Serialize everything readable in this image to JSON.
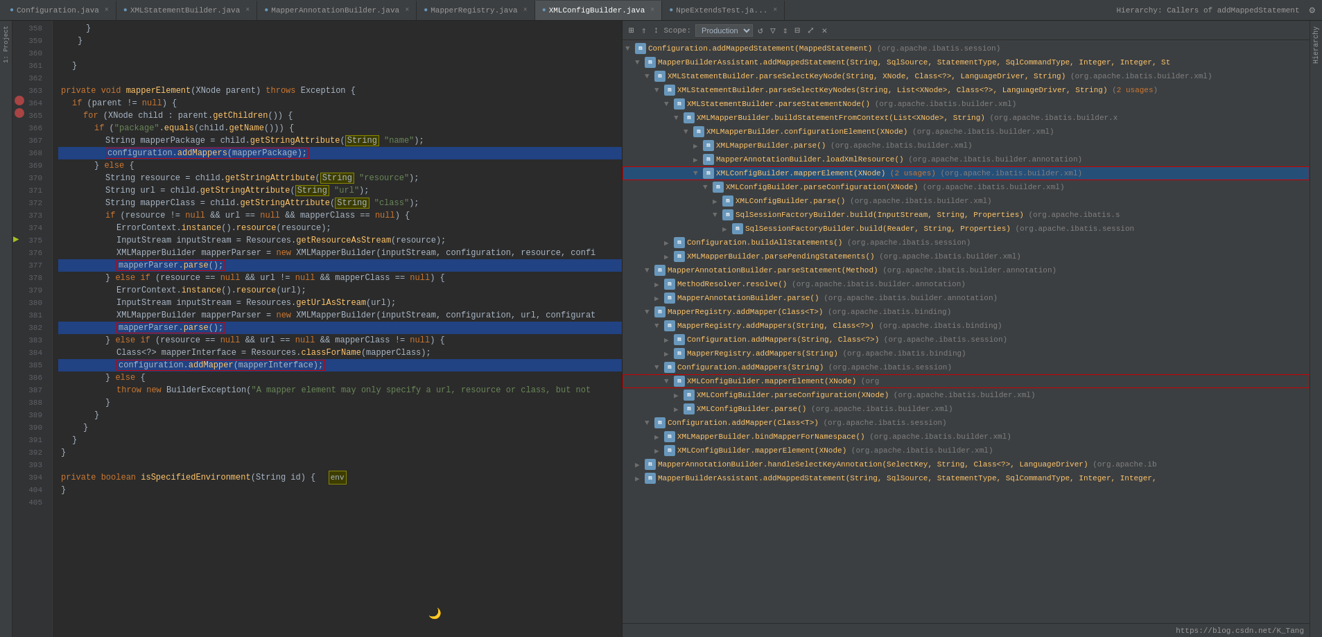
{
  "tabs": [
    {
      "label": "Configuration.java",
      "active": false,
      "color": "#6897bb"
    },
    {
      "label": "XMLStatementBuilder.java",
      "active": false,
      "color": "#6897bb"
    },
    {
      "label": "MapperAnnotationBuilder.java",
      "active": false,
      "color": "#6897bb"
    },
    {
      "label": "MapperRegistry.java",
      "active": false,
      "color": "#6897bb"
    },
    {
      "label": "XMLConfigBuilder.java",
      "active": true,
      "color": "#6897bb"
    },
    {
      "label": "NpeExtendsTest.ja...",
      "active": false,
      "color": "#6897bb"
    }
  ],
  "hierarchy_title": "Hierarchy: Callers of addMappedStatement",
  "scope": {
    "label": "Scope:",
    "value": "Production"
  },
  "toolbar_buttons": [
    "refresh",
    "settings",
    "expand",
    "locate",
    "export",
    "close"
  ],
  "code_lines": [
    {
      "num": "358",
      "code": "    }"
    },
    {
      "num": "359",
      "code": "    }"
    },
    {
      "num": "360",
      "code": ""
    },
    {
      "num": "361",
      "code": "    }"
    },
    {
      "num": "362",
      "code": ""
    },
    {
      "num": "363",
      "code": "    private void mapperElement(XNode parent) throws Exception {"
    },
    {
      "num": "364",
      "code": "        if (parent != null) {"
    },
    {
      "num": "365",
      "code": "            for (XNode child : parent.getChildren()) {"
    },
    {
      "num": "366",
      "code": "                if (\"package\".equals(child.getName())) {"
    },
    {
      "num": "367",
      "code": "                    String mapperPackage = child.getStringAttribute( \"name\");"
    },
    {
      "num": "368",
      "code": "                    configuration.addMappers(mapperPackage);",
      "highlight": true
    },
    {
      "num": "369",
      "code": "                } else {"
    },
    {
      "num": "370",
      "code": "                    String resource = child.getStringAttribute( \"resource\");"
    },
    {
      "num": "371",
      "code": "                    String url = child.getStringAttribute( \"url\");"
    },
    {
      "num": "372",
      "code": "                    String mapperClass = child.getStringAttribute( \"class\");"
    },
    {
      "num": "373",
      "code": "                    if (resource != null && url == null && mapperClass == null) {"
    },
    {
      "num": "374",
      "code": "                        ErrorContext.instance().resource(resource);"
    },
    {
      "num": "375",
      "code": "                        InputStream inputStream = Resources.getResourceAsStream(resource);"
    },
    {
      "num": "376",
      "code": "                        XMLMapperBuilder mapperParser = new XMLMapperBuilder(inputStream, configuration, resource, confi"
    },
    {
      "num": "377",
      "code": "                        mapperParser.parse();",
      "highlight": true
    },
    {
      "num": "378",
      "code": "                    } else if (resource == null && url != null && mapperClass == null) {"
    },
    {
      "num": "379",
      "code": "                        ErrorContext.instance().resource(url);"
    },
    {
      "num": "380",
      "code": "                        InputStream inputStream = Resources.getUrlAsStream(url);"
    },
    {
      "num": "381",
      "code": "                        XMLMapperBuilder mapperParser = new XMLMapperBuilder(inputStream, configuration, url, configurat"
    },
    {
      "num": "382",
      "code": "                        mapperParser.parse();",
      "highlight": true
    },
    {
      "num": "383",
      "code": "                    } else if (resource == null && url == null && mapperClass != null) {"
    },
    {
      "num": "384",
      "code": "                        Class<?> mapperInterface = Resources.classForName(mapperClass);"
    },
    {
      "num": "385",
      "code": "                        configuration.addMapper(mapperInterface);",
      "highlight": true
    },
    {
      "num": "386",
      "code": "                    } else {"
    },
    {
      "num": "387",
      "code": "                        throw new BuilderException(\"A mapper element may only specify a url, resource or class, but not"
    },
    {
      "num": "388",
      "code": "                    }"
    },
    {
      "num": "389",
      "code": "                }"
    },
    {
      "num": "390",
      "code": "            }"
    },
    {
      "num": "391",
      "code": "        }"
    },
    {
      "num": "392",
      "code": "    }"
    },
    {
      "num": "393",
      "code": ""
    },
    {
      "num": "394",
      "code": "    private boolean isSpecifiedEnvironment(String id) {"
    },
    {
      "num": "404",
      "code": "    }"
    }
  ],
  "hierarchy_items": [
    {
      "indent": 0,
      "arrow": "▼",
      "icon": "m",
      "text": "Configuration.addMappedStatement(MappedStatement)",
      "pkg": "(org.apache.ibatis.session)",
      "level": 0
    },
    {
      "indent": 1,
      "arrow": "▼",
      "icon": "m",
      "text": "MapperBuilderAssistant.addMappedStatement(String, SqlSource, StatementType, SqlCommandType, Integer, Integer, St",
      "pkg": "",
      "level": 1
    },
    {
      "indent": 2,
      "arrow": "▼",
      "icon": "m",
      "text": "XMLStatementBuilder.parseSelectKeyNode(String, XNode, Class<?>, LanguageDriver, String)",
      "pkg": "(org.apache.ibatis.builder.xml)",
      "level": 2
    },
    {
      "indent": 3,
      "arrow": "▼",
      "icon": "m",
      "text": "XMLStatementBuilder.parseSelectKeyNodes(String, List<XNode>, Class<?>, LanguageDriver, String)",
      "pkg": "(2 usages)",
      "level": 3
    },
    {
      "indent": 4,
      "arrow": "▼",
      "icon": "m",
      "text": "XMLStatementBuilder.parseStatementNode()",
      "pkg": "(org.apache.ibatis.builder.xml)",
      "level": 4
    },
    {
      "indent": 5,
      "arrow": "▼",
      "icon": "m",
      "text": "XMLMapperBuilder.buildStatementFromContext(List<XNode>, String)",
      "pkg": "(org.apache.ibatis.builder.x",
      "level": 5
    },
    {
      "indent": 6,
      "arrow": "▼",
      "icon": "m",
      "text": "XMLMapperBuilder.configurationElement(XNode)",
      "pkg": "(org.apache.ibatis.builder.xml)",
      "level": 6
    },
    {
      "indent": 7,
      "arrow": "▶",
      "icon": "m",
      "text": "XMLMapperBuilder.parse()",
      "pkg": "(org.apache.ibatis.builder.xml)",
      "level": 7
    },
    {
      "indent": 7,
      "arrow": "▶",
      "icon": "m",
      "text": "MapperAnnotationBuilder.loadXmlResource()",
      "pkg": "(org.apache.ibatis.builder.annotation)",
      "level": 7
    },
    {
      "indent": 7,
      "arrow": "▼",
      "icon": "m",
      "text": "XMLConfigBuilder.mapperElement(XNode)(2 usages)",
      "pkg": "(org.apache.ibatis.builder.xml)",
      "level": 7,
      "active": true,
      "red_outline": true
    },
    {
      "indent": 8,
      "arrow": "▼",
      "icon": "m",
      "text": "XMLConfigBuilder.parseConfiguration(XNode)",
      "pkg": "(org.apache.ibatis.builder.xml)",
      "level": 8
    },
    {
      "indent": 9,
      "arrow": "▶",
      "icon": "m",
      "text": "XMLConfigBuilder.parse()",
      "pkg": "(org.apache.ibatis.builder.xml)",
      "level": 9
    },
    {
      "indent": 9,
      "arrow": "▼",
      "icon": "m",
      "text": "SqlSessionFactoryBuilder.build(InputStream, String, Properties)",
      "pkg": "(org.apache.ibatis.s",
      "level": 9
    },
    {
      "indent": 10,
      "arrow": "▶",
      "icon": "m",
      "text": "SqlSessionFactoryBuilder.build(Reader, String, Properties)",
      "pkg": "(org.apache.ibatis.session",
      "level": 10
    },
    {
      "indent": 3,
      "arrow": "▶",
      "icon": "m",
      "text": "Configuration.buildAllStatements()",
      "pkg": "(org.apache.ibatis.session)",
      "level": 3
    },
    {
      "indent": 3,
      "arrow": "▶",
      "icon": "m",
      "text": "XMLMapperBuilder.parsePendingStatements()",
      "pkg": "(org.apache.ibatis.builder.xml)",
      "level": 3
    },
    {
      "indent": 2,
      "arrow": "▼",
      "icon": "m",
      "text": "MapperAnnotationBuilder.parseStatement(Method)",
      "pkg": "(org.apache.ibatis.builder.annotation)",
      "level": 2
    },
    {
      "indent": 3,
      "arrow": "▶",
      "icon": "m",
      "text": "MethodResolver.resolve()",
      "pkg": "(org.apache.ibatis.builder.annotation)",
      "level": 3
    },
    {
      "indent": 3,
      "arrow": "▶",
      "icon": "m",
      "text": "MapperAnnotationBuilder.parse()",
      "pkg": "(org.apache.ibatis.builder.annotation)",
      "level": 3
    },
    {
      "indent": 2,
      "arrow": "▼",
      "icon": "m",
      "text": "MapperRegistry.addMapper(Class<T>)",
      "pkg": "(org.apache.ibatis.binding)",
      "level": 2
    },
    {
      "indent": 3,
      "arrow": "▼",
      "icon": "m",
      "text": "MapperRegistry.addMappers(String, Class<?>)",
      "pkg": "(org.apache.ibatis.binding)",
      "level": 3
    },
    {
      "indent": 4,
      "arrow": "▶",
      "icon": "m",
      "text": "Configuration.addMappers(String, Class<?>)",
      "pkg": "(org.apache.ibatis.session)",
      "level": 4
    },
    {
      "indent": 4,
      "arrow": "▶",
      "icon": "m",
      "text": "MapperRegistry.addMappers(String)",
      "pkg": "(org.apache.ibatis.binding)",
      "level": 4
    },
    {
      "indent": 3,
      "arrow": "▼",
      "icon": "m",
      "text": "Configuration.addMappers(String)",
      "pkg": "(org.apache.ibatis.session)",
      "level": 3
    },
    {
      "indent": 4,
      "arrow": "▼",
      "icon": "m",
      "text": "XMLConfigBuilder.mapperElement(XNode)",
      "pkg": "(org",
      "level": 4,
      "red_outline": true
    },
    {
      "indent": 5,
      "arrow": "▶",
      "icon": "m",
      "text": "XMLConfigBuilder.parseConfiguration(XNode)",
      "pkg": "(org.apache.ibatis.builder.xml)",
      "level": 5
    },
    {
      "indent": 5,
      "arrow": "▶",
      "icon": "m",
      "text": "XMLConfigBuilder.parse()",
      "pkg": "(org.apache.ibatis.builder.xml)",
      "level": 5
    },
    {
      "indent": 2,
      "arrow": "▼",
      "icon": "m",
      "text": "Configuration.addMapper(Class<T>)",
      "pkg": "(org.apache.ibatis.session)",
      "level": 2
    },
    {
      "indent": 3,
      "arrow": "▶",
      "icon": "m",
      "text": "XMLMapperBuilder.bindMapperForNamespace()",
      "pkg": "(org.apache.ibatis.builder.xml)",
      "level": 3
    },
    {
      "indent": 3,
      "arrow": "▶",
      "icon": "m",
      "text": "XMLConfigBuilder.mapperElement(XNode)",
      "pkg": "(org.apache.ibatis.builder.xml)",
      "level": 3
    },
    {
      "indent": 1,
      "arrow": "▶",
      "icon": "m",
      "text": "MapperAnnotationBuilder.handleSelectKeyAnnotation(SelectKey, String, Class<?>, LanguageDriver)",
      "pkg": "(org.apache.ib",
      "level": 1
    },
    {
      "indent": 1,
      "arrow": "▶",
      "icon": "m",
      "text": "MapperBuilderAssistant.addMappedStatement(String, SqlSource, StatementType, SqlCommandType, Integer, Integer,",
      "pkg": "",
      "level": 1
    }
  ],
  "bottom_bar": {
    "url": "https://blog.csdn.net/K_Tang"
  }
}
